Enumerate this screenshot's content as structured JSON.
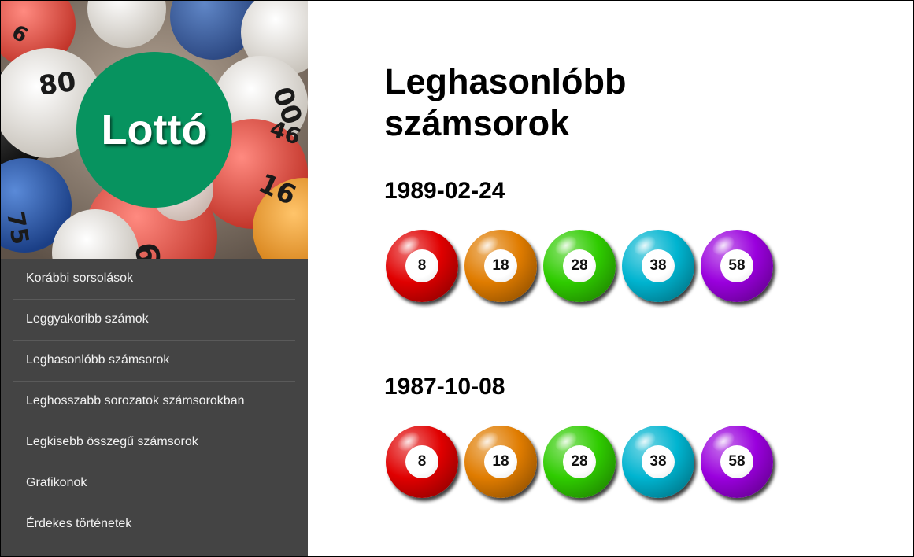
{
  "brand": {
    "logo_text": "Lottó",
    "logo_color": "#07935f"
  },
  "sidebar": {
    "background": "#444444",
    "items": [
      {
        "label": "Korábbi sorsolások"
      },
      {
        "label": "Leggyakoribb számok"
      },
      {
        "label": "Leghasonlóbb számsorok"
      },
      {
        "label": "Leghosszabb sorozatok számsorokban"
      },
      {
        "label": "Legkisebb összegű számsorok"
      },
      {
        "label": "Grafikonok"
      },
      {
        "label": "Érdekes történetek"
      }
    ]
  },
  "main": {
    "title": "Leghasonlóbb számsorok",
    "draws": [
      {
        "date": "1989-02-24",
        "numbers": [
          "8",
          "18",
          "28",
          "38",
          "58"
        ]
      },
      {
        "date": "1987-10-08",
        "numbers": [
          "8",
          "18",
          "28",
          "38",
          "58"
        ]
      }
    ],
    "ball_colors": [
      "#e00000",
      "#e07c00",
      "#2fcc00",
      "#00b4d0",
      "#9a00dd"
    ]
  }
}
